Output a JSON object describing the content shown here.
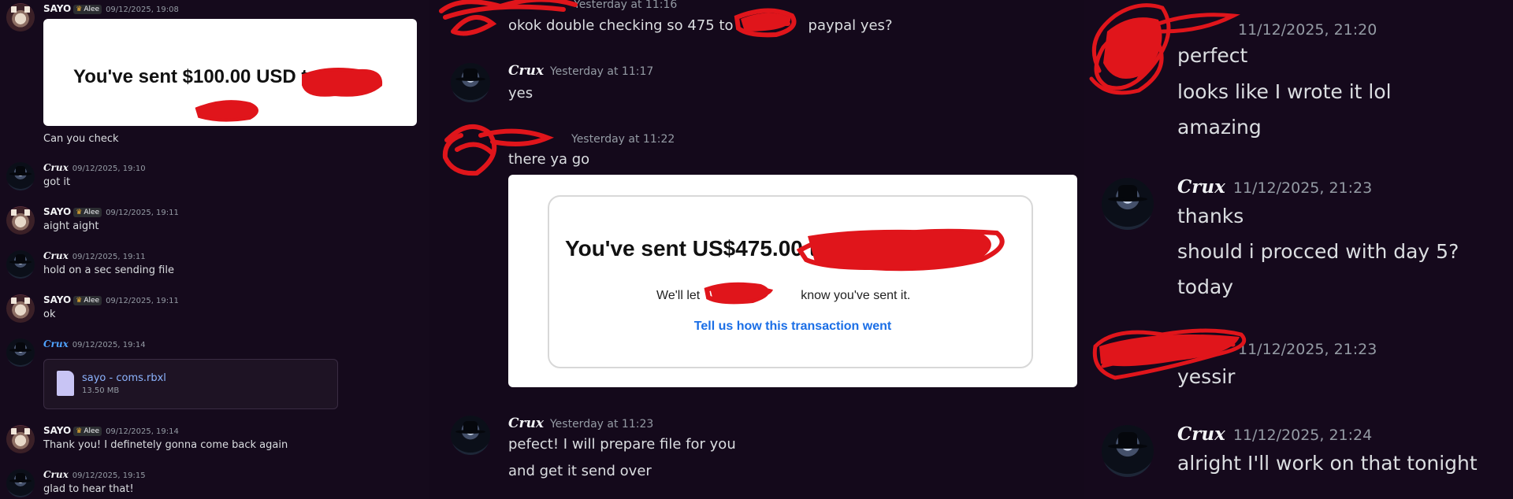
{
  "users": {
    "sayo": "SAYO",
    "sayo_badge": "Alee",
    "crux": "Crux"
  },
  "panel1": {
    "m1": {
      "time": "09/12/2025, 19:08",
      "image_text_before": "You've sent",
      "image_amount": "$100.00 USD",
      "image_text_to": "to",
      "text": "Can you check"
    },
    "m2": {
      "time": "09/12/2025, 19:10",
      "text": "got it"
    },
    "m3": {
      "time": "09/12/2025, 19:11",
      "text": "aight aight"
    },
    "m4": {
      "time": "09/12/2025, 19:11",
      "text": "hold on a sec sending file"
    },
    "m5": {
      "time": "09/12/2025, 19:11",
      "text": "ok"
    },
    "m6": {
      "time": "09/12/2025, 19:14",
      "file_name": "sayo - coms.rbxl",
      "file_size": "13.50 MB"
    },
    "m7": {
      "time": "09/12/2025, 19:14",
      "text": "Thank you! I definetely gonna come back again"
    },
    "m8": {
      "time": "09/12/2025, 19:15",
      "text": "glad to hear that!"
    }
  },
  "panel2": {
    "m1": {
      "time": "Yesterday at 11:16",
      "text_a": "okok double checking so 475 to",
      "text_b": "paypal yes?"
    },
    "m2": {
      "time": "Yesterday at 11:17",
      "text": "yes"
    },
    "m3": {
      "time": "Yesterday at 11:22",
      "text": "there ya go"
    },
    "receipt": {
      "headline": "You've sent US$475.00 to",
      "sub_a": "We'll let",
      "sub_b": "know you've sent it.",
      "link": "Tell us how this transaction went"
    },
    "m4": {
      "time": "Yesterday at 11:23",
      "line1": "pefect! I will prepare file for you",
      "line2": "and get it send over"
    }
  },
  "panel3": {
    "m1": {
      "time": "11/12/2025, 21:20",
      "lines": [
        "perfect",
        "looks like I wrote it lol",
        "amazing"
      ]
    },
    "m2": {
      "time": "11/12/2025, 21:23",
      "lines": [
        "thanks",
        "should i procced with day 5?",
        "today"
      ]
    },
    "m3": {
      "time": "11/12/2025, 21:23",
      "text": "yessir"
    },
    "m4": {
      "time": "11/12/2025, 21:24",
      "text": "alright I'll work on that tonight"
    }
  },
  "colors": {
    "background": "#150a1c",
    "redaction": "#e0151b",
    "link": "#1a6ee6",
    "file_link": "#8cb4ff"
  }
}
